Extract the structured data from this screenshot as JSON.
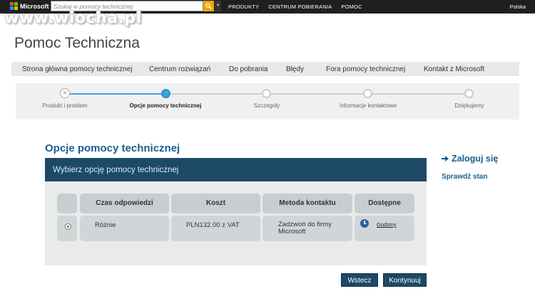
{
  "topbar": {
    "brand": "Microsoft",
    "search_placeholder": "Szukaj w pomocy technicznej",
    "nav": [
      "PRODUKTY",
      "CENTRUM POBIERANIA",
      "POMOC"
    ],
    "region": "Polska"
  },
  "watermark": "www.wiocha.pl",
  "page_title": "Pomoc Techniczna",
  "nav": {
    "items": [
      "Strona główna pomocy technicznej",
      "Centrum rozwiązań",
      "Do pobrania",
      "Błędy",
      "Fora pomocy technicznej",
      "Kontakt z Microsoft"
    ]
  },
  "progress": {
    "steps": [
      {
        "label": "Produkt i problem",
        "state": "done"
      },
      {
        "label": "Opcje pomocy technicznej",
        "state": "active"
      },
      {
        "label": "Szczegóły",
        "state": "pending"
      },
      {
        "label": "Informacje kontaktowe",
        "state": "pending"
      },
      {
        "label": "Dziękujemy",
        "state": "pending"
      }
    ]
  },
  "main": {
    "section_title": "Opcje pomocy technicznej",
    "panel_title": "Wybierz opcję pomocy technicznej",
    "table": {
      "headers": [
        "Czas odpowiedzi",
        "Koszt",
        "Metoda kontaktu",
        "Dostępne"
      ],
      "rows": [
        {
          "time": "Różnie",
          "cost": "PLN132.00 z VAT",
          "method": "Zadzwoń do firmy Microsoft",
          "availability": "Godziny",
          "selected": true
        }
      ]
    },
    "back_label": "Wstecz",
    "continue_label": "Kontynuuj"
  },
  "side": {
    "login_label": "Zaloguj się",
    "status_label": "Sprawdź stan"
  },
  "colors": {
    "accent": "#1c4966",
    "progress_active": "#3ba4d9",
    "title_blue": "#1a5f8e"
  }
}
